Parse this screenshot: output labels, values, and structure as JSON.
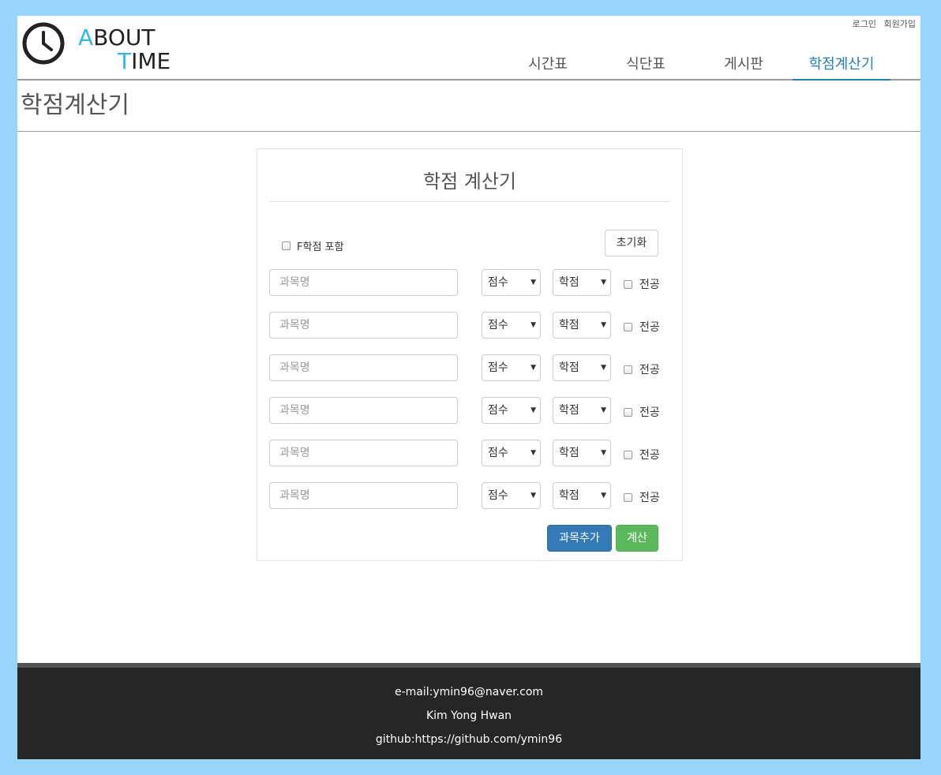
{
  "header": {
    "logo": {
      "line1_accent": "A",
      "line1_rest": "BOUT",
      "line2_accent": "T",
      "line2_rest": "IME"
    },
    "top_links": {
      "login": "로그인",
      "signup": "회원가입"
    },
    "nav": [
      {
        "label": "시간표",
        "active": false
      },
      {
        "label": "식단표",
        "active": false
      },
      {
        "label": "게시판",
        "active": false
      },
      {
        "label": "학점계산기",
        "active": true
      }
    ]
  },
  "page_title": "학점계산기",
  "calculator": {
    "title": "학점 계산기",
    "include_f_label": "F학점 포함",
    "include_f_checked": false,
    "reset_label": "초기화",
    "rows": [
      {
        "course_placeholder": "과목명",
        "score": "점수",
        "credit": "학점",
        "major_label": "전공",
        "major_checked": false
      },
      {
        "course_placeholder": "과목명",
        "score": "점수",
        "credit": "학점",
        "major_label": "전공",
        "major_checked": false
      },
      {
        "course_placeholder": "과목명",
        "score": "점수",
        "credit": "학점",
        "major_label": "전공",
        "major_checked": false
      },
      {
        "course_placeholder": "과목명",
        "score": "점수",
        "credit": "학점",
        "major_label": "전공",
        "major_checked": false
      },
      {
        "course_placeholder": "과목명",
        "score": "점수",
        "credit": "학점",
        "major_label": "전공",
        "major_checked": false
      },
      {
        "course_placeholder": "과목명",
        "score": "점수",
        "credit": "학점",
        "major_label": "전공",
        "major_checked": false
      }
    ],
    "add_course_label": "과목추가",
    "calculate_label": "계산"
  },
  "footer": {
    "email": "e-mail:ymin96@naver.com",
    "name": "Kim Yong Hwan",
    "github": "github:https://github.com/ymin96"
  },
  "colors": {
    "background": "#97d5fb",
    "accent": "#35b5f0",
    "nav_active": "#2a7bb0",
    "primary_button": "#337ab7",
    "success_button": "#5cb85c",
    "footer": "#262626"
  }
}
